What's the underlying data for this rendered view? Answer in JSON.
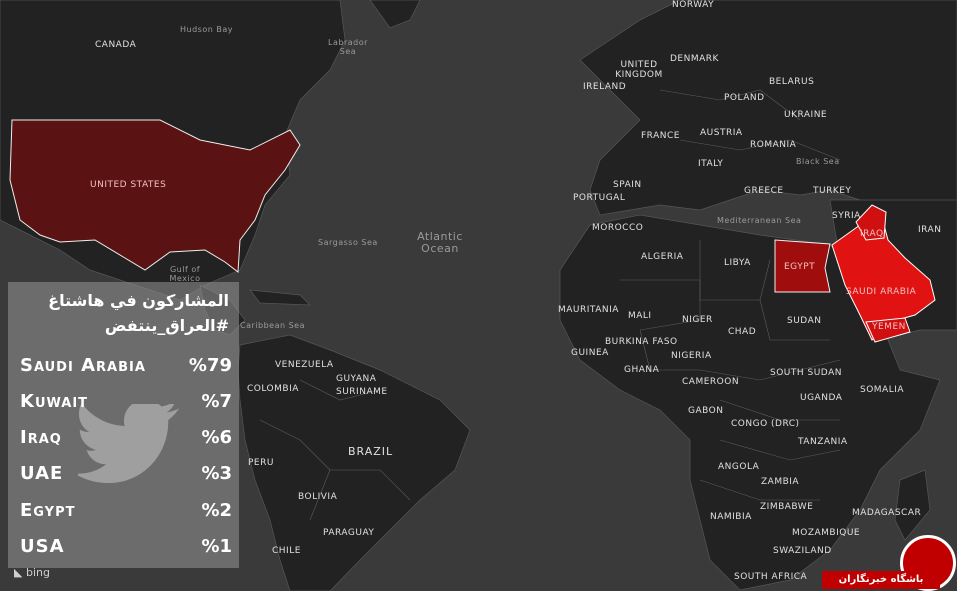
{
  "panel": {
    "title_line1": "المشاركون في هاشتاغ",
    "title_line2": "#العراق_ينتفض",
    "rows": [
      {
        "country": "Saudi Arabia",
        "percent": "%79"
      },
      {
        "country": "Kuwait",
        "percent": "%7"
      },
      {
        "country": "Iraq",
        "percent": "%6"
      },
      {
        "country": "UAE",
        "percent": "%3"
      },
      {
        "country": "Egypt",
        "percent": "%2"
      },
      {
        "country": "USA",
        "percent": "%1"
      }
    ]
  },
  "map_labels": {
    "canada": "CANADA",
    "hudson": "Hudson Bay",
    "labrador": "Labrador Sea",
    "us": "UNITED STATES",
    "sargasso": "Sargasso Sea",
    "atlantic": "Atlantic Ocean",
    "gulf": "Gulf of Mexico",
    "caribbean": "Caribbean Sea",
    "venezuela": "VENEZUELA",
    "colombia": "COLOMBIA",
    "guyana": "GUYANA",
    "suriname": "SURINAME",
    "brazil": "BRAZIL",
    "peru": "PERU",
    "bolivia": "BOLIVIA",
    "paraguay": "PARAGUAY",
    "chile": "CHILE",
    "norway": "NORWAY",
    "denmark": "DENMARK",
    "uk": "UNITED KINGDOM",
    "ireland": "IRELAND",
    "poland": "POLAND",
    "belarus": "BELARUS",
    "ukraine": "UKRAINE",
    "france": "FRANCE",
    "austria": "AUSTRIA",
    "romania": "ROMANIA",
    "italy": "ITALY",
    "blacksea": "Black Sea",
    "turkey": "TURKEY",
    "spain": "SPAIN",
    "portugal": "PORTUGAL",
    "greece": "GREECE",
    "med": "Mediterranean Sea",
    "syria": "SYRIA",
    "iraq": "IRAQ",
    "iran": "IRAN",
    "morocco": "MOROCCO",
    "algeria": "ALGERIA",
    "libya": "LIBYA",
    "egypt": "EGYPT",
    "saudi": "SAUDI ARABIA",
    "yemen": "YEMEN",
    "mauritania": "MAURITANIA",
    "mali": "MALI",
    "niger": "NIGER",
    "chad": "CHAD",
    "sudan": "SUDAN",
    "burkina": "BURKINA FASO",
    "guinea": "GUINEA",
    "ghana": "GHANA",
    "nigeria": "NIGERIA",
    "ssudan": "SOUTH SUDAN",
    "cameroon": "CAMEROON",
    "somalia": "SOMALIA",
    "uganda": "UGANDA",
    "gabon": "GABON",
    "drc": "CONGO (DRC)",
    "tanzania": "TANZANIA",
    "angola": "ANGOLA",
    "zambia": "ZAMBIA",
    "namibia": "NAMIBIA",
    "zimbabwe": "ZIMBABWE",
    "mozambique": "MOZAMBIQUE",
    "swaziland": "SWAZILAND",
    "safrica": "SOUTH AFRICA",
    "madagascar": "MADAGASCAR",
    "bing": "bing",
    "brand": "باشگاه خبرنگاران"
  },
  "colors": {
    "land": "#222222",
    "water": "#3a3a3a",
    "usa": "#5a1212",
    "egypt": "#b01010",
    "saudi": "#e01010",
    "border": "#6a6a6a"
  }
}
